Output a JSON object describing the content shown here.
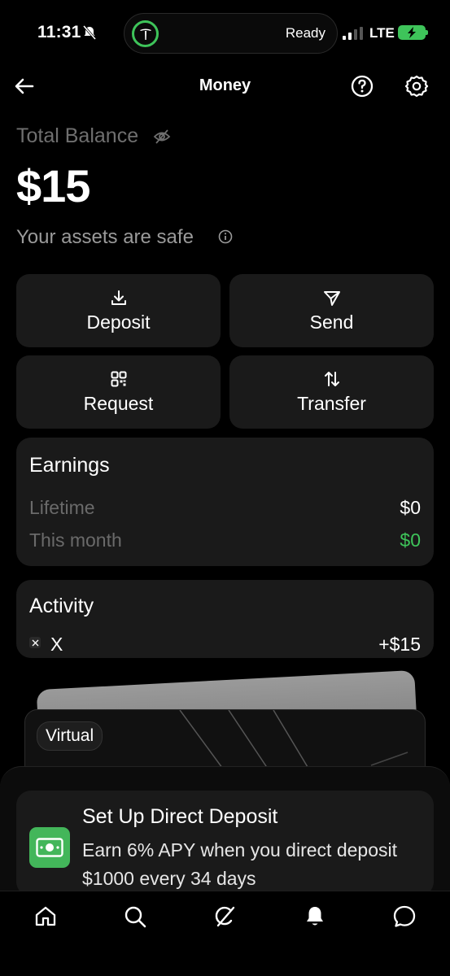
{
  "status_bar": {
    "time": "11:31",
    "live_activity_text": "Ready",
    "network": "LTE",
    "accent_green": "#3ec45a"
  },
  "header": {
    "title": "Money",
    "back_icon": "arrow-left-icon",
    "help_icon": "help-circle-icon",
    "settings_icon": "gear-icon"
  },
  "balance": {
    "label": "Total Balance",
    "value": "$15",
    "safety_note": "Your assets are safe"
  },
  "actions": [
    {
      "label": "Deposit",
      "icon": "download-icon"
    },
    {
      "label": "Send",
      "icon": "send-icon"
    },
    {
      "label": "Request",
      "icon": "qr-code-icon"
    },
    {
      "label": "Transfer",
      "icon": "swap-arrows-icon"
    }
  ],
  "earnings": {
    "title": "Earnings",
    "rows": [
      {
        "label": "Lifetime",
        "value": "$0"
      },
      {
        "label": "This month",
        "value": "$0"
      }
    ]
  },
  "activity": {
    "title": "Activity",
    "items": [
      {
        "name": "X",
        "amount": "+$15"
      }
    ]
  },
  "virtual_card": {
    "badge": "Virtual"
  },
  "direct_deposit": {
    "title": "Set Up Direct Deposit",
    "subtitle": "Earn 6% APY when you direct deposit $1000 every 34 days",
    "icon": "cash-icon",
    "icon_color": "#43b65a"
  },
  "tabbar": {
    "items": [
      "home-icon",
      "search-icon",
      "grok-icon",
      "notifications-icon",
      "messages-icon"
    ]
  }
}
